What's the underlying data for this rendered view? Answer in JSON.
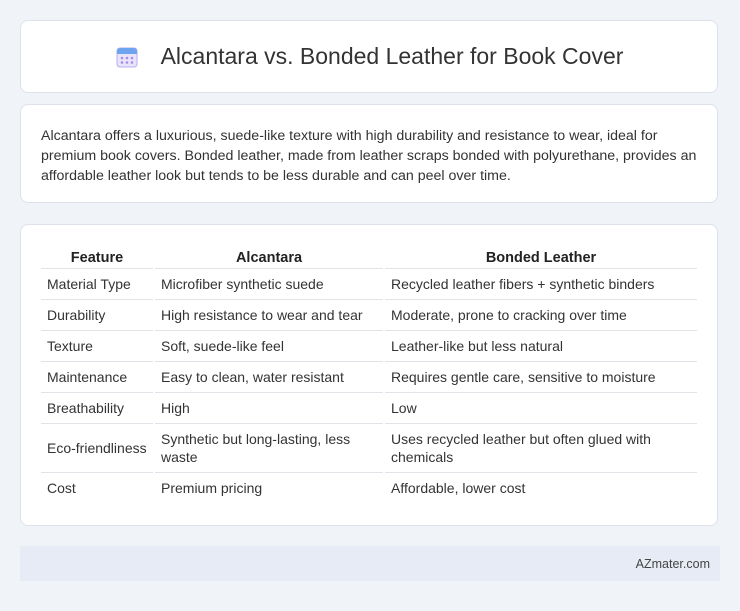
{
  "header": {
    "title": "Alcantara vs. Bonded Leather for Book Cover",
    "icon": "calendar-icon"
  },
  "description": "Alcantara offers a luxurious, suede-like texture with high durability and resistance to wear, ideal for premium book covers. Bonded leather, made from leather scraps bonded with polyurethane, provides an affordable leather look but tends to be less durable and can peel over time.",
  "table": {
    "headers": [
      "Feature",
      "Alcantara",
      "Bonded Leather"
    ],
    "rows": [
      [
        "Material Type",
        "Microfiber synthetic suede",
        "Recycled leather fibers + synthetic binders"
      ],
      [
        "Durability",
        "High resistance to wear and tear",
        "Moderate, prone to cracking over time"
      ],
      [
        "Texture",
        "Soft, suede-like feel",
        "Leather-like but less natural"
      ],
      [
        "Maintenance",
        "Easy to clean, water resistant",
        "Requires gentle care, sensitive to moisture"
      ],
      [
        "Breathability",
        "High",
        "Low"
      ],
      [
        "Eco-friendliness",
        "Synthetic but long-lasting, less waste",
        "Uses recycled leather but often glued with chemicals"
      ],
      [
        "Cost",
        "Premium pricing",
        "Affordable, lower cost"
      ]
    ]
  },
  "footer": {
    "brand": "AZmater.com"
  },
  "colors": {
    "background": "#f0f3f8",
    "footer_bg": "#e6ebf5",
    "icon_accent": "#7b6fd6"
  }
}
